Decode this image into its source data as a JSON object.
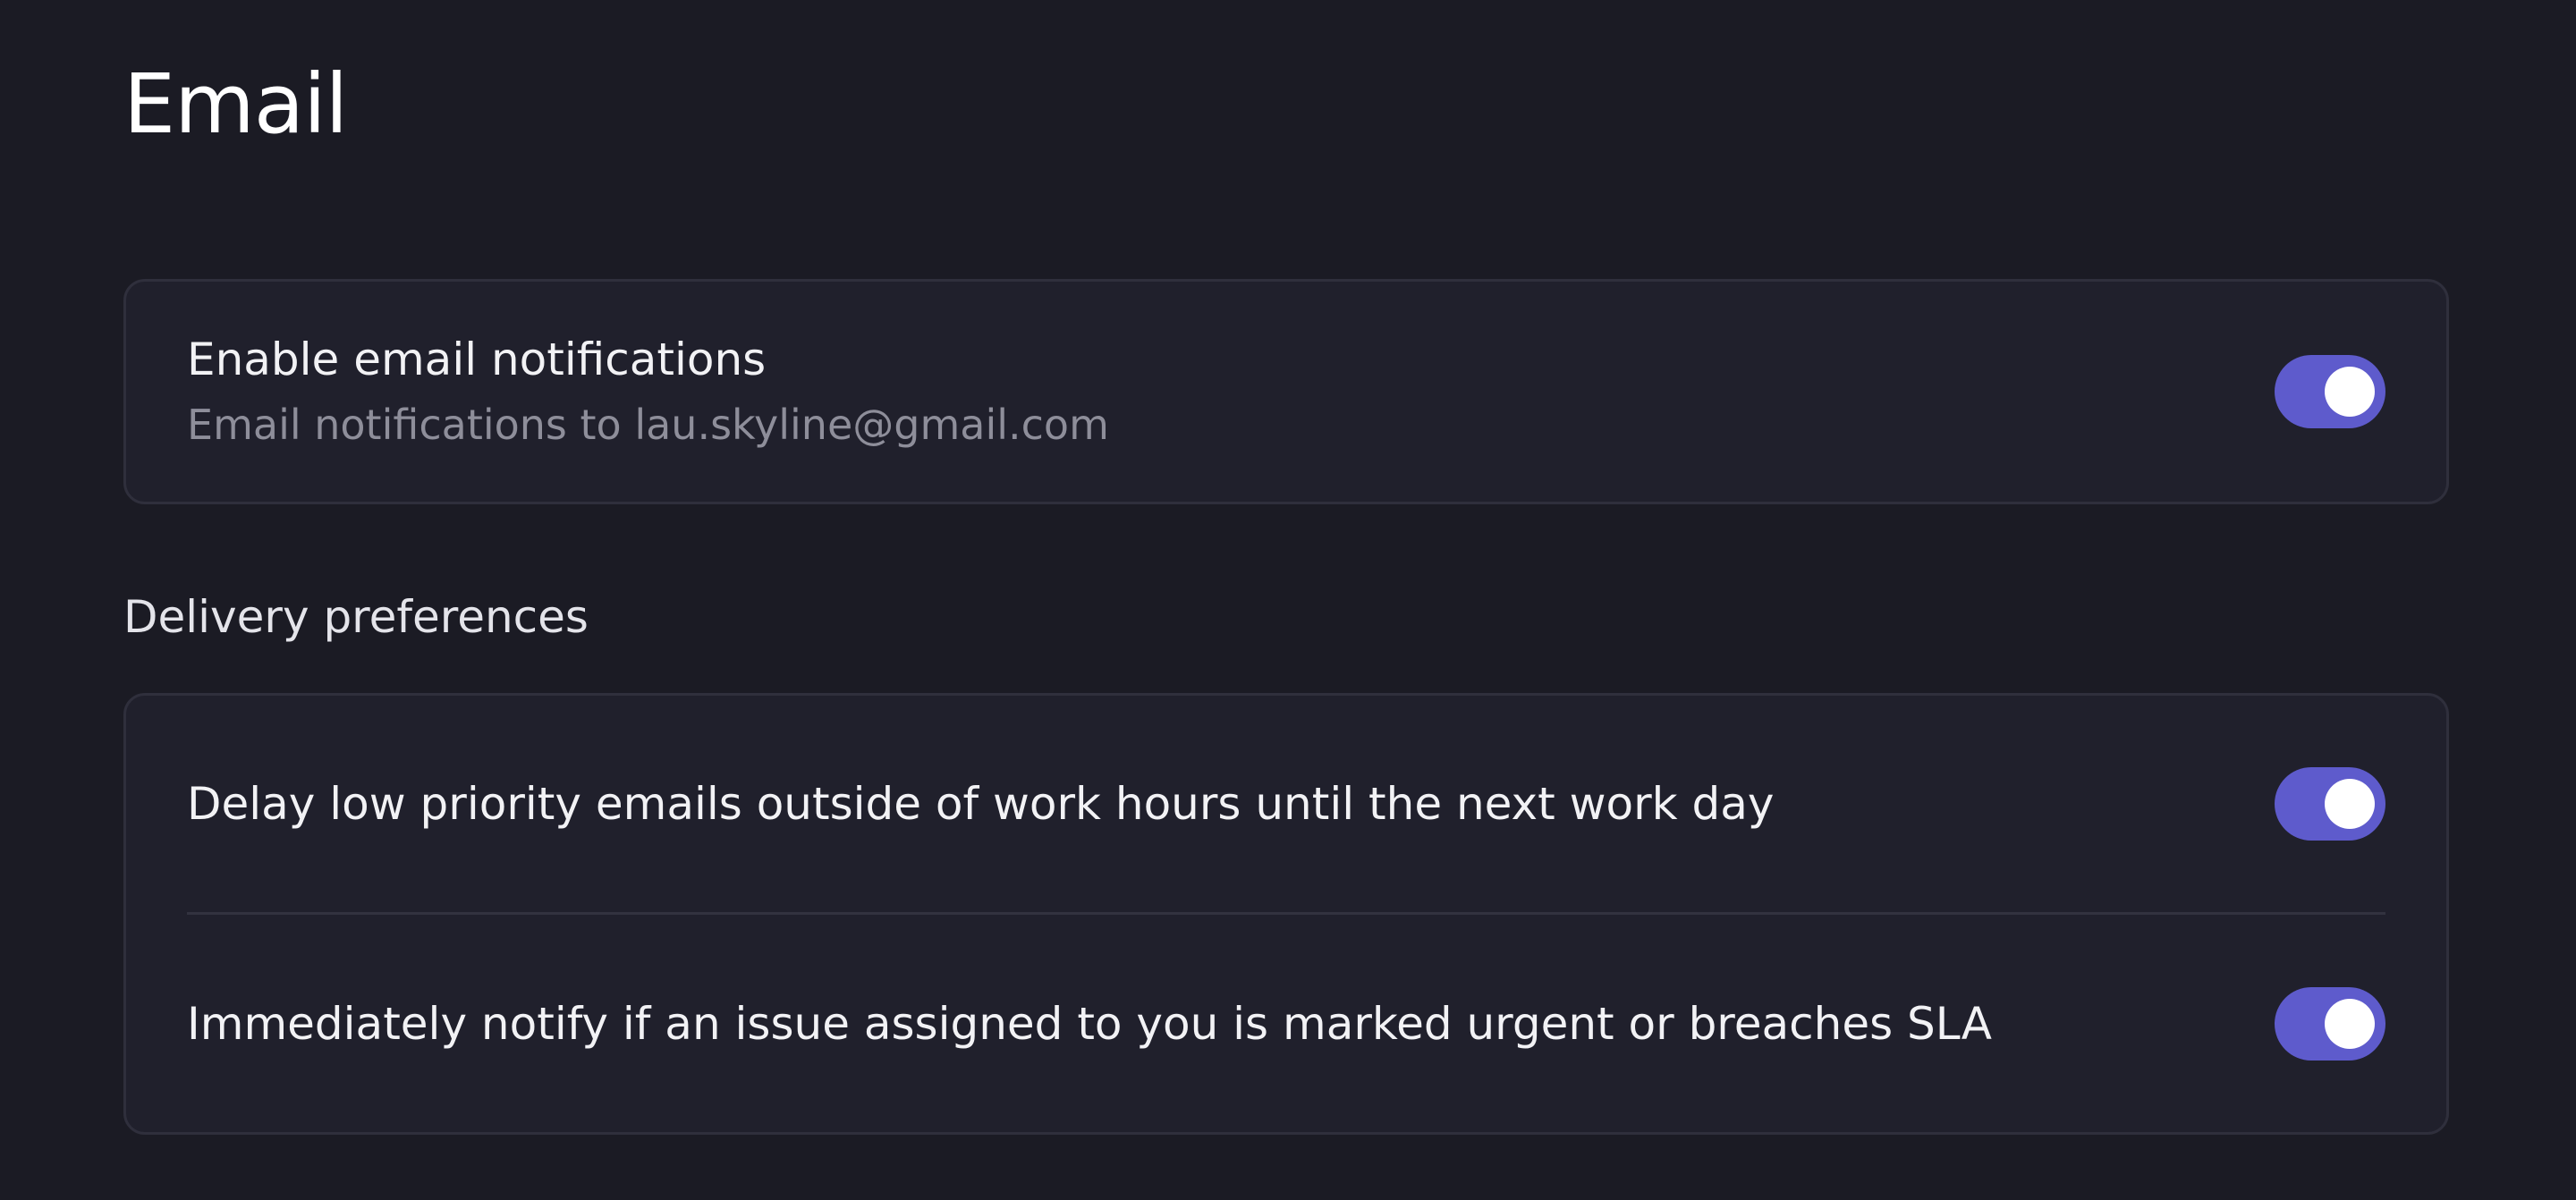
{
  "page": {
    "title": "Email"
  },
  "enable_card": {
    "title": "Enable email notifications",
    "subtitle": "Email notifications to lau.skyline@gmail.com",
    "toggle_on": true
  },
  "delivery": {
    "section_label": "Delivery preferences",
    "items": [
      {
        "label": "Delay low priority emails outside of work hours until the next work day",
        "toggle_on": true
      },
      {
        "label": "Immediately notify if an issue assigned to you is marked urgent or breaches SLA",
        "toggle_on": true
      }
    ]
  },
  "colors": {
    "background": "#1b1b24",
    "card": "#20202c",
    "accent": "#5e5bcc"
  }
}
